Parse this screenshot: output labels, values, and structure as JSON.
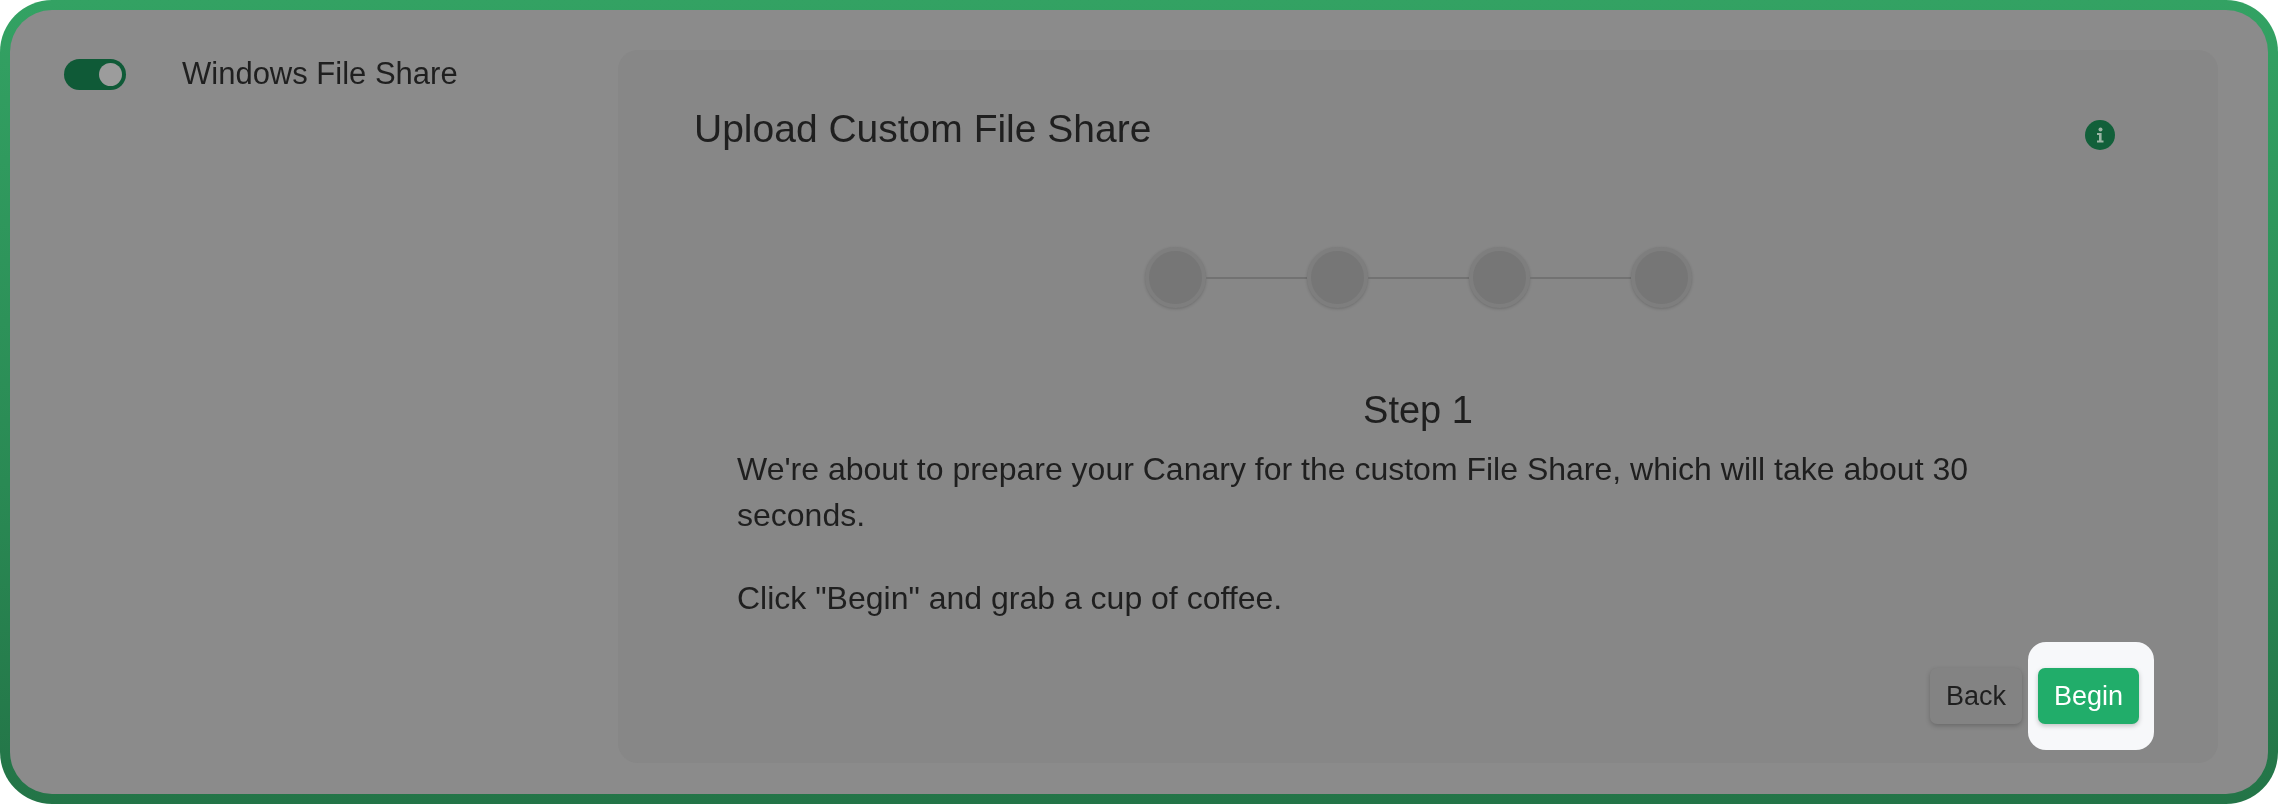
{
  "setting": {
    "label": "Windows File Share",
    "on": true
  },
  "dialog": {
    "title": "Upload Custom File Share",
    "steps": [
      {
        "active": false
      },
      {
        "active": false
      },
      {
        "active": false
      },
      {
        "active": false
      }
    ],
    "step_title": "Step 1",
    "paragraphs": [
      "We're about to prepare your Canary for the custom File Share, which will take about 30 seconds.",
      "Click \"Begin\" and grab a cup of coffee."
    ],
    "buttons": [
      {
        "label": "Back",
        "kind": "secondary",
        "highlighted": false
      },
      {
        "label": "Begin",
        "kind": "primary",
        "highlighted": true
      }
    ]
  }
}
